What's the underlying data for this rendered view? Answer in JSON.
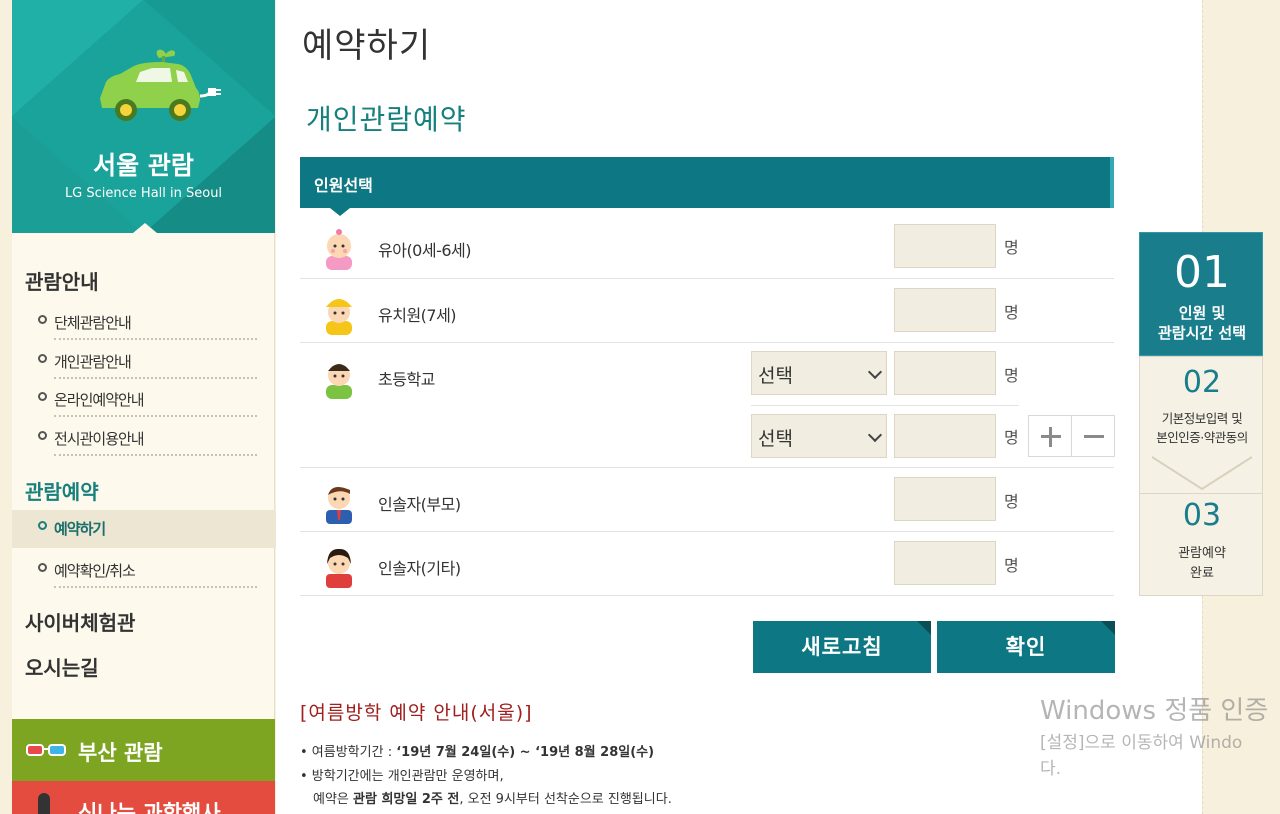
{
  "sidebar": {
    "title": "서울 관람",
    "subtitle": "LG Science Hall in Seoul",
    "groups": [
      {
        "heading": "관람안내",
        "items": [
          "단체관람안내",
          "개인관람안내",
          "온라인예약안내",
          "전시관이용안내"
        ]
      },
      {
        "heading": "관람예약",
        "items": [
          "예약하기",
          "예약확인/취소"
        ]
      }
    ],
    "link_cyber": "사이버체험관",
    "link_directions": "오시는길",
    "banner_busan": "부산 관람",
    "banner_science": "신나는 과학행사"
  },
  "main": {
    "page_title": "예약하기",
    "section_title": "개인관람예약",
    "panel_heading": "인원선택",
    "unit": "명",
    "rows": [
      {
        "label": "유아(0세-6세)"
      },
      {
        "label": "유치원(7세)"
      },
      {
        "label": "초등학교",
        "select": "선택",
        "select2": "선택"
      },
      {
        "label": "인솔자(부모)"
      },
      {
        "label": "인솔자(기타)"
      }
    ],
    "btn_reset": "새로고침",
    "btn_confirm": "확인",
    "notice_title": "[여름방학 예약 안내(서울)]",
    "notice_l1_prefix": "• 여름방학기간 : ",
    "notice_l1_bold": "‘19년 7월 24일(수) ~ ‘19년 8월 28일(수)",
    "notice_l2": "• 방학기간에는 개인관람만 운영하며,",
    "notice_l3_prefix": "예약은 ",
    "notice_l3_bold": "관람 희망일 2주 전",
    "notice_l3_suffix": ", 오전 9시부터 선착순으로 진행됩니다."
  },
  "steps": [
    {
      "num": "01",
      "line1": "인원 및",
      "line2": "관람시간 선택"
    },
    {
      "num": "02",
      "line1": "기본정보입력 및",
      "line2": "본인인증·약관동의"
    },
    {
      "num": "03",
      "line1": "관람예약",
      "line2": "완료"
    }
  ],
  "watermark": {
    "line1": "Windows 정품 인증",
    "line2": "[설정]으로 이동하여 Windo",
    "line3": "다."
  },
  "colors": {
    "teal": "#0d7883",
    "sidebar_teal": "#1aa39b",
    "busan_green": "#7ea522",
    "science_red": "#e34c3f",
    "notice_red": "#a01f1f"
  }
}
